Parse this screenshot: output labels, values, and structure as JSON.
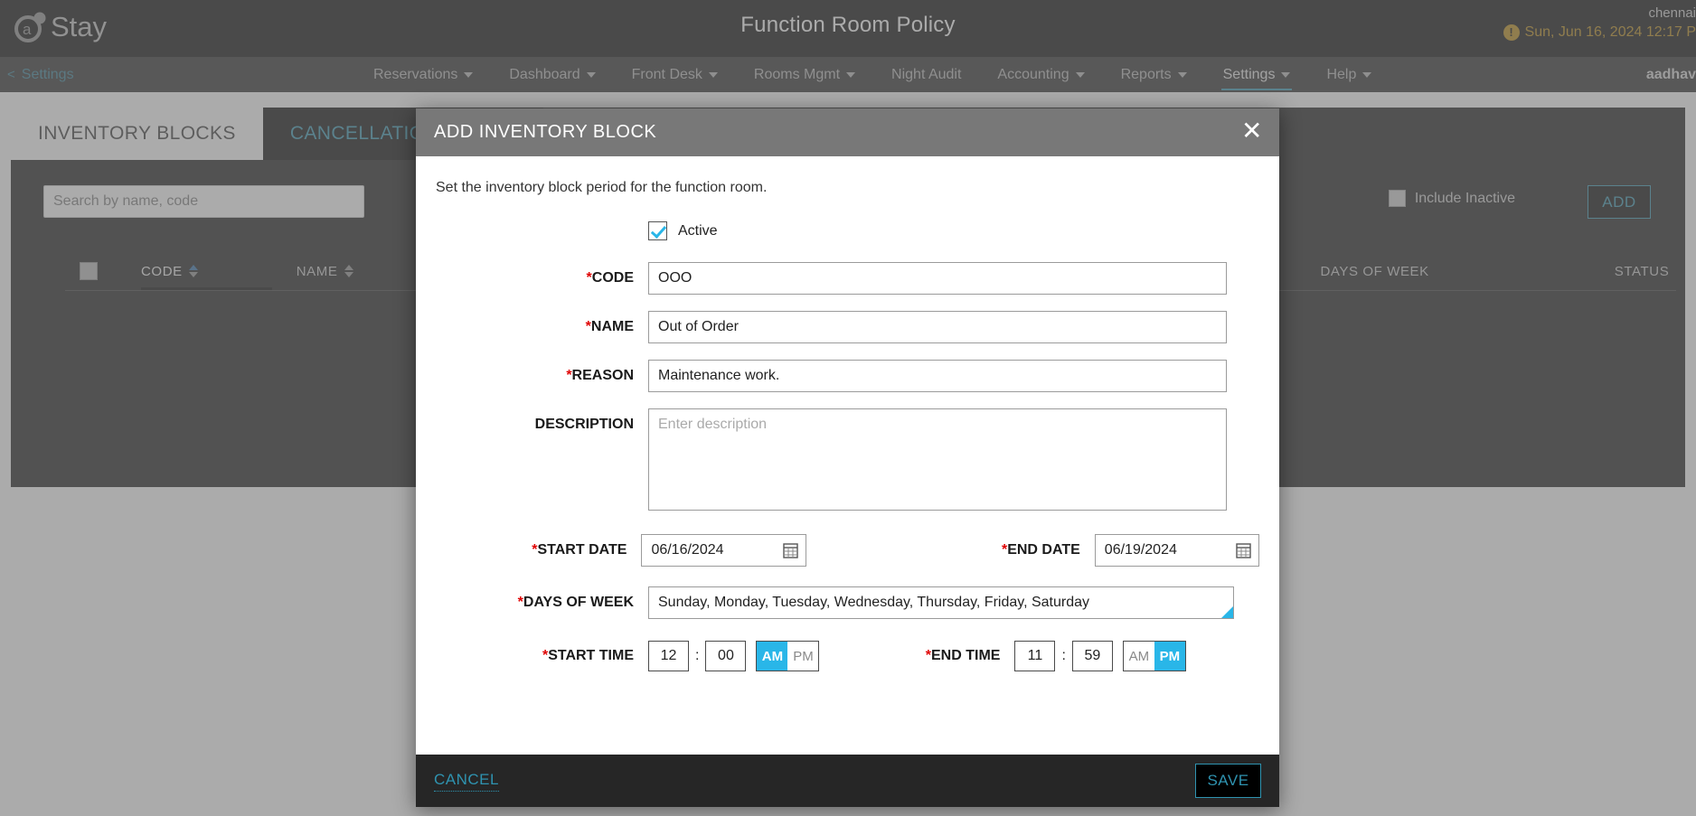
{
  "header": {
    "brand_name": "Stay",
    "page_title": "Function Room Policy",
    "property_name": "chennai",
    "datetime": "Sun, Jun 16, 2024 12:17 P",
    "alert_icon": "alert-icon",
    "user_name": "aadhav"
  },
  "breadcrumb": {
    "back_chevron": "<",
    "label": "Settings"
  },
  "nav": {
    "items": [
      {
        "label": "Reservations",
        "has_caret": true,
        "active": false
      },
      {
        "label": "Dashboard",
        "has_caret": true,
        "active": false
      },
      {
        "label": "Front Desk",
        "has_caret": true,
        "active": false
      },
      {
        "label": "Rooms Mgmt",
        "has_caret": true,
        "active": false
      },
      {
        "label": "Night Audit",
        "has_caret": false,
        "active": false
      },
      {
        "label": "Accounting",
        "has_caret": true,
        "active": false
      },
      {
        "label": "Reports",
        "has_caret": true,
        "active": false
      },
      {
        "label": "Settings",
        "has_caret": true,
        "active": true
      },
      {
        "label": "Help",
        "has_caret": true,
        "active": false
      }
    ]
  },
  "tabs": [
    {
      "label": "INVENTORY BLOCKS",
      "active": true
    },
    {
      "label": "CANCELLATION POLICY",
      "active": false
    }
  ],
  "toolbar": {
    "search_placeholder": "Search by name, code",
    "search_value": "",
    "print_icon": "print-icon",
    "include_inactive_label": "Include Inactive",
    "include_inactive_checked": false,
    "add_label": "ADD"
  },
  "table": {
    "columns": [
      {
        "label": "CODE",
        "sorted": true
      },
      {
        "label": "NAME",
        "sorted": false
      },
      {
        "label": "DAYS OF WEEK",
        "sorted": false
      },
      {
        "label": "STATUS",
        "sorted": false
      }
    ],
    "rows": []
  },
  "modal": {
    "title": "ADD INVENTORY BLOCK",
    "close_icon": "close-icon",
    "subtitle": "Set the inventory block period for the function room.",
    "active": {
      "label": "Active",
      "checked": true
    },
    "fields": {
      "code": {
        "label": "CODE",
        "required": true,
        "value": "OOO"
      },
      "name": {
        "label": "NAME",
        "required": true,
        "value": "Out of Order"
      },
      "reason": {
        "label": "REASON",
        "required": true,
        "value": "Maintenance work."
      },
      "description": {
        "label": "DESCRIPTION",
        "required": false,
        "value": "",
        "placeholder": "Enter description"
      },
      "start_date": {
        "label": "START DATE",
        "required": true,
        "value": "06/16/2024",
        "icon": "calendar-icon"
      },
      "end_date": {
        "label": "END DATE",
        "required": true,
        "value": "06/19/2024",
        "icon": "calendar-icon"
      },
      "days_of_week": {
        "label": "DAYS OF WEEK",
        "required": true,
        "value": "Sunday, Monday, Tuesday, Wednesday, Thursday, Friday, Saturday"
      },
      "start_time": {
        "label": "START TIME",
        "required": true,
        "hour": "12",
        "separator": ":",
        "minute": "00",
        "am_label": "AM",
        "pm_label": "PM",
        "meridiem": "AM"
      },
      "end_time": {
        "label": "END TIME",
        "required": true,
        "hour": "11",
        "separator": ":",
        "minute": "59",
        "am_label": "AM",
        "pm_label": "PM",
        "meridiem": "PM"
      }
    },
    "footer": {
      "cancel_label": "CANCEL",
      "save_label": "SAVE"
    }
  },
  "colors": {
    "accent": "#2f93b0",
    "toggle_active": "#29b6e8",
    "required": "#e00000",
    "datetime": "#b8860b",
    "header_bg": "#000000",
    "nav_bg": "#262626"
  }
}
